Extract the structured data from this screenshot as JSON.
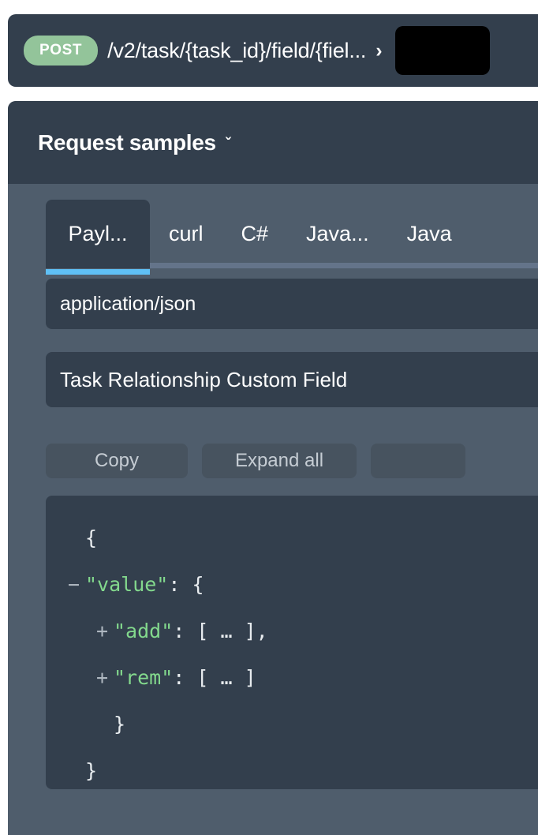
{
  "endpoint": {
    "method": "POST",
    "method_color": "#93c49a",
    "path": "/v2/task/{task_id}/field/{fiel...",
    "expand_chevron": "›",
    "try_it_label": ""
  },
  "samples": {
    "title": "Request samples",
    "collapse_chevron": "ˇ",
    "tabs": [
      {
        "label": "Payl...",
        "active": true
      },
      {
        "label": "curl",
        "active": false
      },
      {
        "label": "C#",
        "active": false
      },
      {
        "label": "Java...",
        "active": false
      },
      {
        "label": "Java",
        "active": false
      }
    ],
    "active_tab_underline_color": "#5fc0f5",
    "content_type": "application/json",
    "schema_title": "Task Relationship Custom Field",
    "actions": {
      "copy_label": "Copy",
      "expand_label": "Expand all",
      "third_label": ""
    },
    "code": {
      "lines": [
        {
          "marker": "",
          "indent": 0,
          "text": "{"
        },
        {
          "marker": "−",
          "indent": 0,
          "key": "\"value\"",
          "text": ": {"
        },
        {
          "marker": "+",
          "indent": 1,
          "key": "\"add\"",
          "text": ": [ … ],"
        },
        {
          "marker": "+",
          "indent": 1,
          "key": "\"rem\"",
          "text": ": [ … ]"
        },
        {
          "marker": "",
          "indent": 1,
          "text": "}"
        },
        {
          "marker": "",
          "indent": 0,
          "text": "}"
        }
      ],
      "key_color": "#83d98d",
      "text_color": "#e8ecef"
    }
  }
}
